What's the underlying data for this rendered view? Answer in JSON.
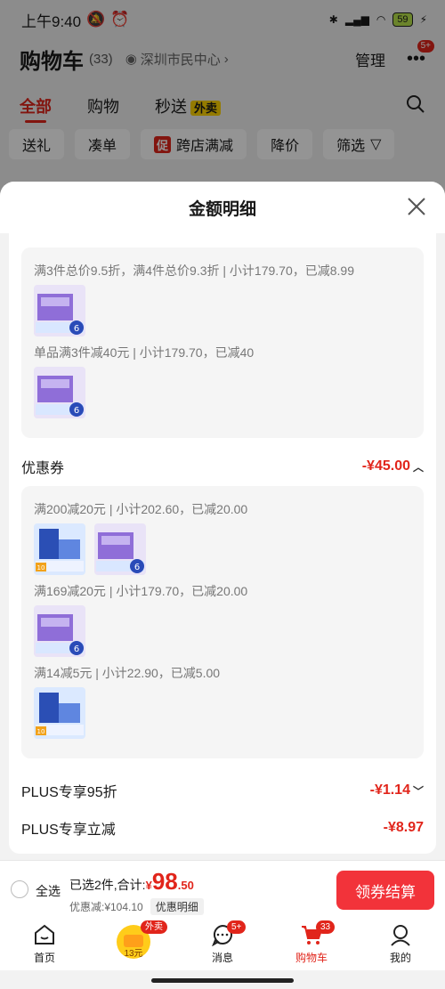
{
  "status_bar": {
    "time": "上午9:40",
    "battery": "59"
  },
  "header": {
    "title": "购物车",
    "count": "(33)",
    "location": "深圳市民中心",
    "manage": "管理",
    "more_badge": "5+"
  },
  "tabs": [
    {
      "label": "全部"
    },
    {
      "label": "购物"
    },
    {
      "label": "秒送"
    }
  ],
  "tab_tag": "外卖",
  "chips": [
    "送礼",
    "凑单",
    "跨店满减",
    "降价",
    "筛选"
  ],
  "chip_promo_tag": "促",
  "sheet": {
    "title": "金额明细",
    "promo_rules": [
      "满3件总价9.5折，满4件总价9.3折 | 小计179.70，已减8.99",
      "单品满3件减40元 | 小计179.70，已减40"
    ],
    "coupon": {
      "label": "优惠券",
      "amount": "-¥45.00"
    },
    "coupon_rules": [
      "满200减20元 | 小计202.60，已减20.00",
      "满169减20元 | 小计179.70，已减20.00",
      "满14减5元 | 小计22.90，已减5.00"
    ],
    "plus_discount": {
      "label": "PLUS专享95折",
      "amount": "-¥1.14"
    },
    "plus_cut": {
      "label": "PLUS专享立减",
      "amount": "-¥8.97"
    }
  },
  "product_badges": {
    "count6": "6",
    "count10": "10"
  },
  "checkout": {
    "select_all": "全选",
    "summary": "已选2件,合计:",
    "currency": "¥",
    "price_int": "98",
    "price_dec": ".50",
    "discount": "优惠减:¥104.10",
    "detail_btn": "优惠明细",
    "pay": "领券结算"
  },
  "nav": [
    {
      "label": "首页"
    },
    {
      "label": "",
      "badge": "外卖",
      "sub": "13元"
    },
    {
      "label": "消息",
      "badge": "5+"
    },
    {
      "label": "购物车",
      "badge": "33"
    },
    {
      "label": "我的"
    }
  ],
  "colors": {
    "accent": "#e1251b",
    "button": "#f2333a"
  }
}
